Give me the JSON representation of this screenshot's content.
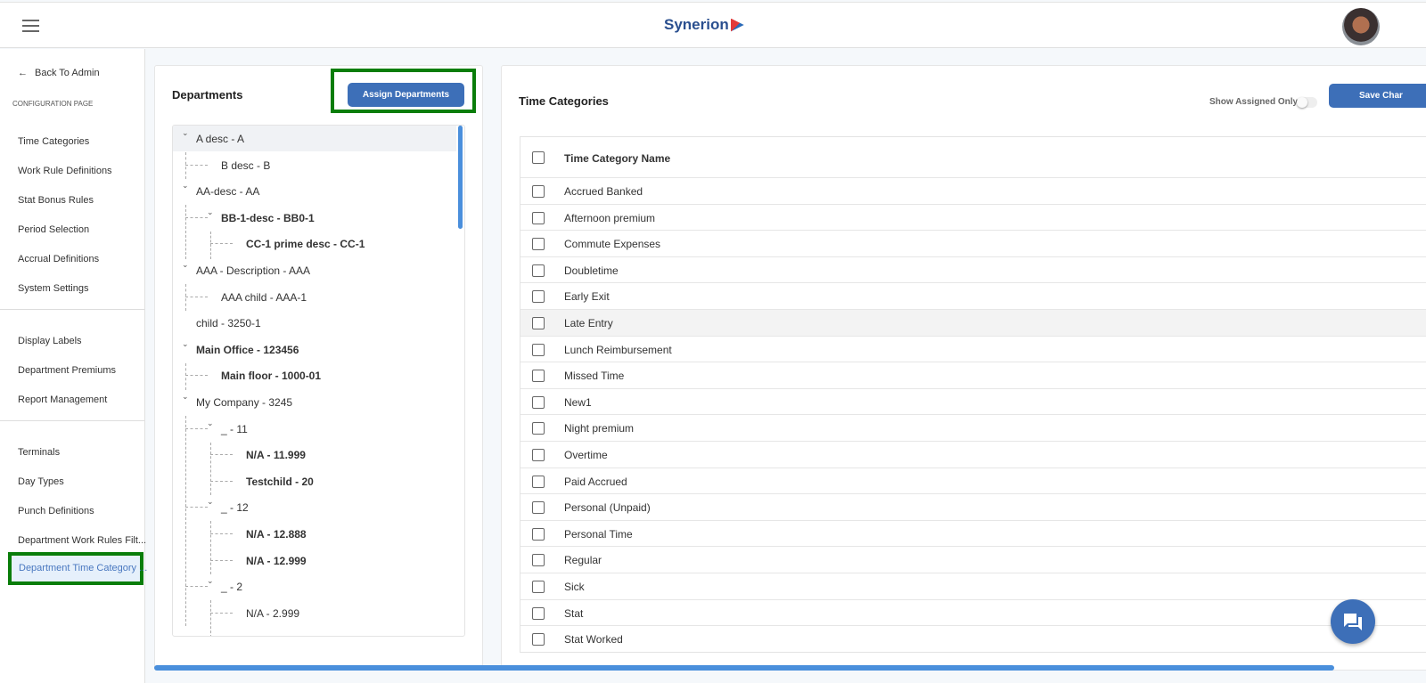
{
  "header": {
    "brand": "Synerion",
    "menu_icon": "hamburger-icon",
    "avatar": "user-avatar"
  },
  "sidebar": {
    "back": "Back To Admin",
    "section": "CONFIGURATION PAGE",
    "group1": [
      "Time Categories",
      "Work Rule Definitions",
      "Stat Bonus Rules",
      "Period Selection",
      "Accrual Definitions",
      "System Settings"
    ],
    "group2": [
      "Display Labels",
      "Department Premiums",
      "Report Management"
    ],
    "group3": [
      "Terminals",
      "Day Types",
      "Punch Definitions",
      "Department Work Rules Filt..."
    ],
    "active": "Department Time Category ..."
  },
  "departments": {
    "title": "Departments",
    "assign_button": "Assign Departments",
    "tree": [
      {
        "label": "A desc - A",
        "level": 0,
        "expanded": true,
        "bold": false,
        "selected": true
      },
      {
        "label": "B desc - B",
        "level": 1,
        "bold": false
      },
      {
        "label": "AA-desc - AA",
        "level": 0,
        "expanded": true,
        "bold": false
      },
      {
        "label": "BB-1-desc - BB0-1",
        "level": 1,
        "expanded": true,
        "bold": true
      },
      {
        "label": "CC-1 prime desc - CC-1",
        "level": 2,
        "bold": true
      },
      {
        "label": "AAA - Description - AAA",
        "level": 0,
        "expanded": true,
        "bold": false
      },
      {
        "label": "AAA child - AAA-1",
        "level": 1,
        "bold": false
      },
      {
        "label": "child - 3250-1",
        "level": 0,
        "bold": false
      },
      {
        "label": "Main Office - 123456",
        "level": 0,
        "expanded": true,
        "bold": true
      },
      {
        "label": "Main floor - 1000-01",
        "level": 1,
        "bold": true
      },
      {
        "label": "My Company - 3245",
        "level": 0,
        "expanded": true,
        "bold": false
      },
      {
        "label": "_ - 11",
        "level": 1,
        "expanded": true,
        "bold": false
      },
      {
        "label": "N/A - 11.999",
        "level": 2,
        "bold": true
      },
      {
        "label": "Testchild - 20",
        "level": 2,
        "bold": true
      },
      {
        "label": "_ - 12",
        "level": 1,
        "expanded": true,
        "bold": false
      },
      {
        "label": "N/A - 12.888",
        "level": 2,
        "bold": true
      },
      {
        "label": "N/A - 12.999",
        "level": 2,
        "bold": true
      },
      {
        "label": "_ - 2",
        "level": 1,
        "expanded": true,
        "bold": false
      },
      {
        "label": "N/A - 2.999",
        "level": 2,
        "bold": false
      }
    ]
  },
  "time_categories": {
    "title": "Time Categories",
    "show_assigned_label": "Show Assigned Only",
    "show_assigned_on": false,
    "save_button": "Save Char",
    "column_header": "Time Category Name",
    "rows": [
      "Accrued Banked",
      "Afternoon premium",
      "Commute Expenses",
      "Doubletime",
      "Early Exit",
      "Late Entry",
      "Lunch Reimbursement",
      "Missed Time",
      "New1",
      "Night premium",
      "Overtime",
      "Paid Accrued",
      "Personal (Unpaid)",
      "Personal Time",
      "Regular",
      "Sick",
      "Stat",
      "Stat Worked"
    ]
  },
  "colors": {
    "accent": "#3d6fb8",
    "highlight": "#0a7d0a"
  }
}
